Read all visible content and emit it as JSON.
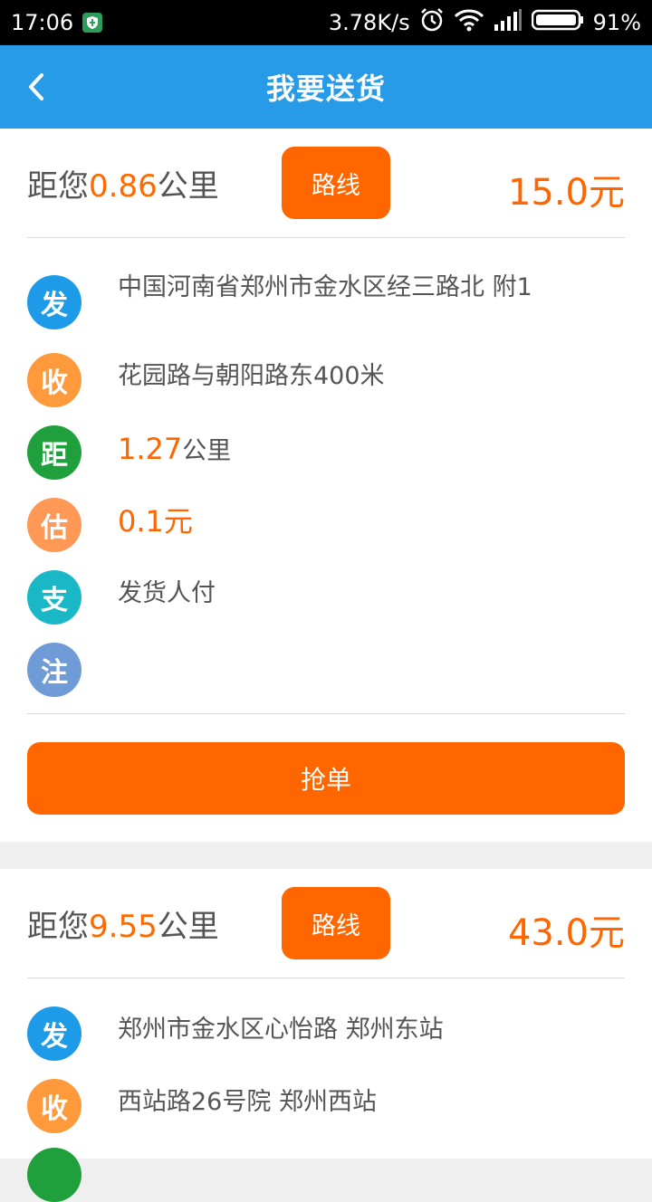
{
  "status_bar": {
    "time": "17:06",
    "network_speed": "3.78K/s",
    "battery": "91%",
    "icons": [
      "shield-icon",
      "alarm-icon",
      "wifi-icon",
      "signal-icon",
      "battery-icon"
    ]
  },
  "app_bar": {
    "title": "我要送货",
    "back_icon": "chevron-left-icon"
  },
  "colors": {
    "header_blue": "#289be8",
    "accent_orange": "#ff6600",
    "badge_send": "#1e9be8",
    "badge_receive": "#ff9a3c",
    "badge_distance": "#1fa03c",
    "badge_estimate": "#ff9955",
    "badge_pay": "#1ab8c6",
    "badge_note": "#6f9bd6"
  },
  "orders": [
    {
      "distance_prefix": "距您",
      "distance_value": "0.86",
      "distance_unit": "公里",
      "route_label": "路线",
      "price": "15.0元",
      "send_badge": "发",
      "send_address": "中国河南省郑州市金水区经三路北       附1",
      "receive_badge": "收",
      "receive_address": "花园路与朝阳路东400米 ",
      "distance_badge": "距",
      "trip_distance_value": "1.27",
      "trip_distance_unit": "公里",
      "estimate_badge": "估",
      "estimate_value": "0.1元",
      "pay_badge": "支",
      "pay_text": "发货人付",
      "note_badge": "注",
      "note_text": "",
      "grab_label": "抢单"
    },
    {
      "distance_prefix": "距您",
      "distance_value": "9.55",
      "distance_unit": "公里",
      "route_label": "路线",
      "price": "43.0元",
      "send_badge": "发",
      "send_address": "郑州市金水区心怡路 郑州东站",
      "receive_badge": "收",
      "receive_address": "西站路26号院 郑州西站"
    }
  ]
}
